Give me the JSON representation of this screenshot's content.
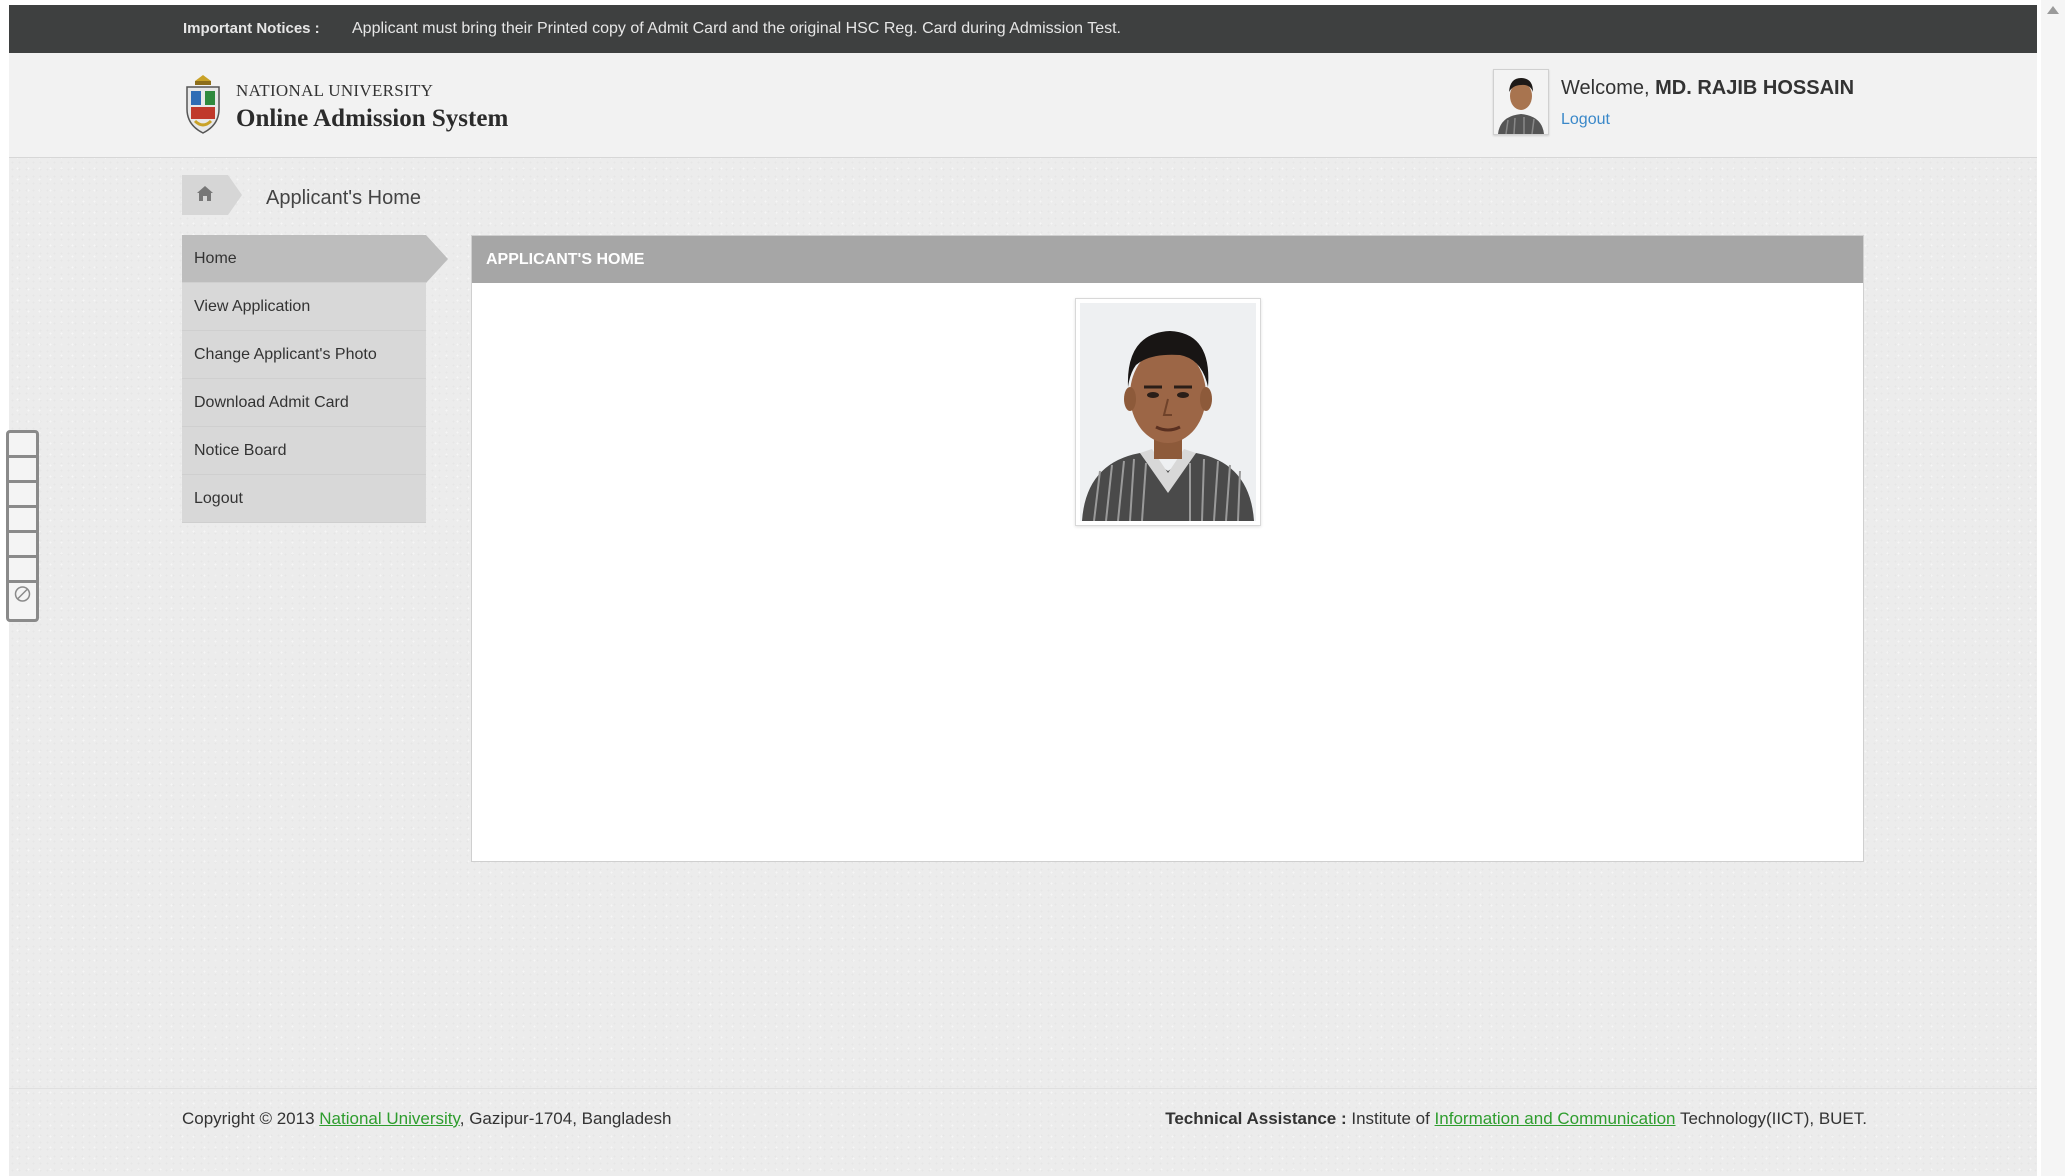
{
  "notice": {
    "label": "Important Notices :",
    "text": "Applicant must bring their Printed copy of Admit Card and the original HSC Reg. Card during Admission Test."
  },
  "header": {
    "university": "NATIONAL UNIVERSITY",
    "system_name": "Online Admission System",
    "welcome_prefix": "Welcome,",
    "user_name": "MD. RAJIB HOSSAIN",
    "logout_label": "Logout"
  },
  "breadcrumb": {
    "home_icon": "home-icon",
    "title": "Applicant's Home"
  },
  "menu": {
    "items": [
      {
        "label": "Home",
        "active": true
      },
      {
        "label": "View Application"
      },
      {
        "label": "Change Applicant's Photo"
      },
      {
        "label": "Download Admit Card"
      },
      {
        "label": "Notice Board"
      },
      {
        "label": "Logout"
      }
    ]
  },
  "panel": {
    "title": "APPLICANT'S HOME"
  },
  "footer": {
    "copyright_prefix": "Copyright © 2013",
    "copyright_link": "National University",
    "copyright_suffix": ", Gazipur-1704, Bangladesh",
    "ta_label": "Technical Assistance :",
    "ta_prefix": "Institute of",
    "ta_link": "Information and Communication",
    "ta_suffix": "Technology(IICT), BUET."
  },
  "colors": {
    "notice_bar": "#3e4040",
    "panel_header": "#a6a6a6",
    "link_blue": "#3a88c9",
    "link_green": "#2e9d2e"
  }
}
